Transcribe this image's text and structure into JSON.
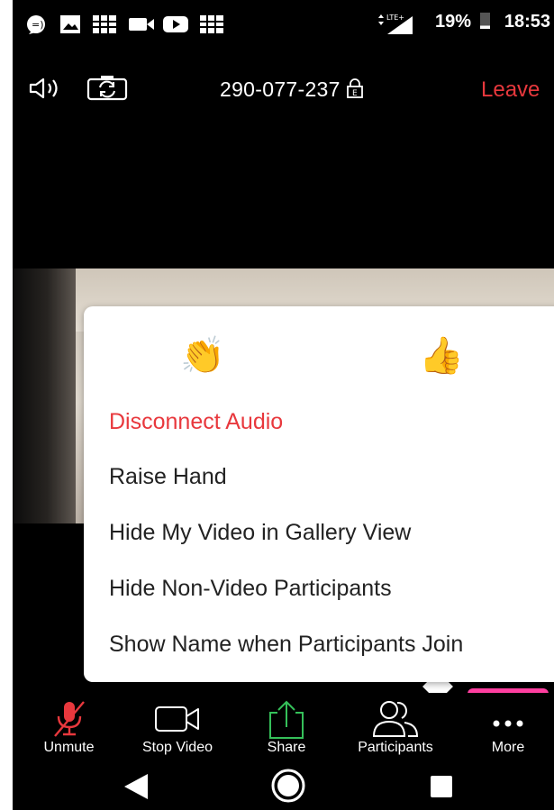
{
  "status_bar": {
    "icons": [
      "chat-icon",
      "image-icon",
      "grid-icon",
      "video-icon",
      "youtube-icon",
      "grid-icon"
    ],
    "network": "LTE+",
    "battery": "19%",
    "time": "18:53"
  },
  "top_bar": {
    "meeting_id": "290-077-237",
    "leave_label": "Leave"
  },
  "menu": {
    "reactions": [
      "👏",
      "👍"
    ],
    "items": [
      {
        "label": "Disconnect Audio",
        "color": "#e8383d"
      },
      {
        "label": "Raise Hand"
      },
      {
        "label": "Hide My Video in Gallery View"
      },
      {
        "label": "Hide Non-Video Participants"
      },
      {
        "label": "Show Name when Participants Join"
      }
    ]
  },
  "toolbar": {
    "unmute_label": "Unmute",
    "stop_video_label": "Stop Video",
    "share_label": "Share",
    "participants_label": "Participants",
    "more_label": "More"
  },
  "colors": {
    "accent_red": "#e8383d",
    "share_green": "#35c05a",
    "highlight_pink": "#ff3fa0"
  }
}
